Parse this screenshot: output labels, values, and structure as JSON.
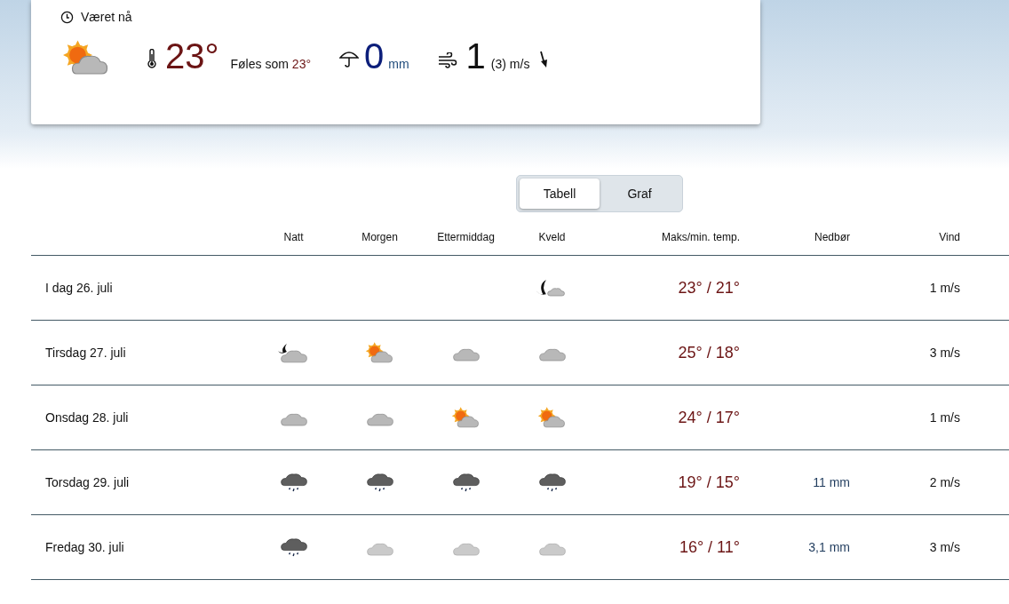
{
  "now": {
    "title": "Været nå",
    "icon": {
      "kind": "sun-cloud"
    },
    "temperature": "23°",
    "feels_label": "Føles som",
    "feels_value": "23°",
    "precipitation": "0",
    "precipitation_unit": "mm",
    "wind": "1",
    "wind_detail": "(3) m/s"
  },
  "view_tabs": [
    {
      "label": "Tabell",
      "selected": true
    },
    {
      "label": "Graf",
      "selected": false
    }
  ],
  "table": {
    "columns": [
      "Natt",
      "Morgen",
      "Ettermiddag",
      "Kveld",
      "Maks/min. temp.",
      "Nedbør",
      "Vind"
    ],
    "rows": [
      {
        "day": "I dag 26. juli",
        "periods": [
          {
            "kind": "empty"
          },
          {
            "kind": "empty"
          },
          {
            "kind": "empty"
          },
          {
            "kind": "moon-cloud"
          }
        ],
        "temp": "23° / 21°",
        "wind": "1 m/s"
      },
      {
        "day": "Tirsdag 27. juli",
        "periods": [
          {
            "kind": "night-cloud"
          },
          {
            "kind": "sun-cloud"
          },
          {
            "kind": "cloud"
          },
          {
            "kind": "cloud"
          }
        ],
        "temp": "25° / 18°",
        "wind": "3 m/s"
      },
      {
        "day": "Onsdag 28. juli",
        "periods": [
          {
            "kind": "cloud"
          },
          {
            "kind": "cloud"
          },
          {
            "kind": "sun-cloud"
          },
          {
            "kind": "sun-cloud"
          }
        ],
        "temp": "24° / 17°",
        "wind": "1 m/s"
      },
      {
        "day": "Torsdag 29. juli",
        "periods": [
          {
            "kind": "rain"
          },
          {
            "kind": "rain"
          },
          {
            "kind": "rain"
          },
          {
            "kind": "rain"
          }
        ],
        "temp": "19° / 15°",
        "precipitation": "11 mm",
        "wind": "2 m/s"
      },
      {
        "day": "Fredag 30. juli",
        "periods": [
          {
            "kind": "rain"
          },
          {
            "kind": "pale-cloud"
          },
          {
            "kind": "pale-cloud"
          },
          {
            "kind": "pale-cloud"
          }
        ],
        "temp": "16° / 11°",
        "precipitation": "3,1 mm",
        "wind": "3 m/s"
      }
    ]
  }
}
